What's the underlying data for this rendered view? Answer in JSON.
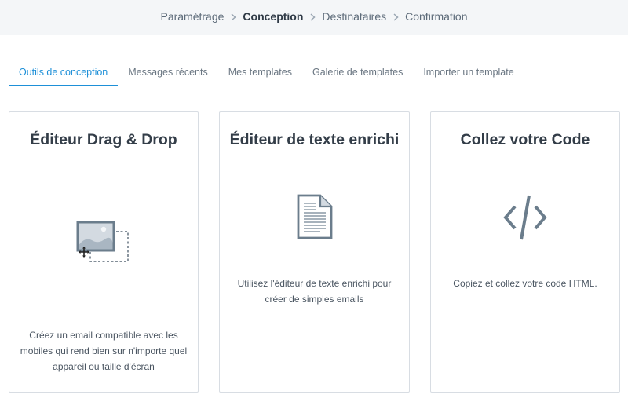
{
  "stepper": {
    "steps": [
      {
        "label": "Paramétrage",
        "active": false
      },
      {
        "label": "Conception",
        "active": true
      },
      {
        "label": "Destinataires",
        "active": false
      },
      {
        "label": "Confirmation",
        "active": false
      }
    ]
  },
  "tabs": [
    {
      "label": "Outils de conception",
      "active": true
    },
    {
      "label": "Messages récents",
      "active": false
    },
    {
      "label": "Mes templates",
      "active": false
    },
    {
      "label": "Galerie de templates",
      "active": false
    },
    {
      "label": "Importer un template",
      "active": false
    }
  ],
  "cards": [
    {
      "title": "Éditeur Drag & Drop",
      "icon": "drag-drop-image-icon",
      "description": "Créez un email compatible avec les mobiles qui rend bien sur n'importe quel appareil ou taille d'écran"
    },
    {
      "title": "Éditeur de texte enrichi",
      "icon": "document-icon",
      "description": "Utilisez l'éditeur de texte enrichi pour créer de simples emails"
    },
    {
      "title": "Collez votre Code",
      "icon": "code-icon",
      "description": "Copiez et collez votre code HTML."
    }
  ],
  "colors": {
    "accent": "#1e90d8",
    "icon": "#6b7d8c",
    "header_bg": "#f4f6f8"
  }
}
